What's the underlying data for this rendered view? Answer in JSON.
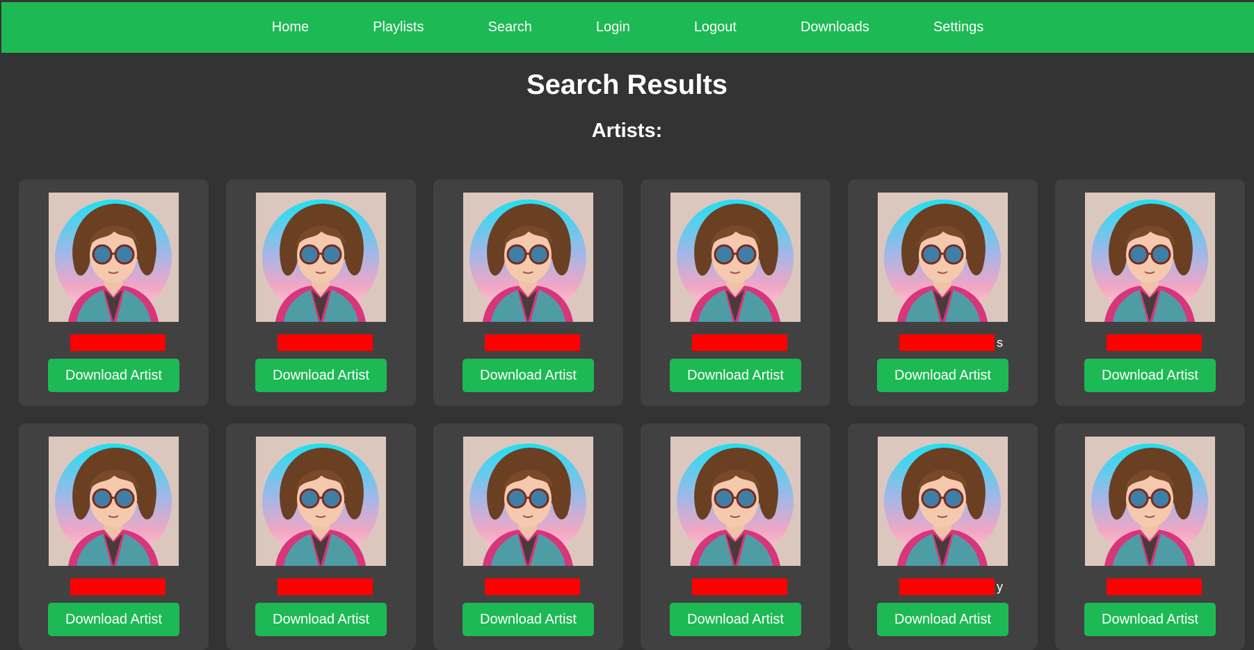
{
  "nav": {
    "items": [
      "Home",
      "Playlists",
      "Search",
      "Login",
      "Logout",
      "Downloads",
      "Settings"
    ]
  },
  "page": {
    "title": "Search Results",
    "section_title": "Artists:"
  },
  "colors": {
    "accent": "#1db954",
    "background": "#333333",
    "card": "#414141",
    "redaction": "#ff0000"
  },
  "artists": [
    {
      "name_tail": "",
      "button_label": "Download Artist"
    },
    {
      "name_tail": "",
      "button_label": "Download Artist"
    },
    {
      "name_tail": "",
      "button_label": "Download Artist"
    },
    {
      "name_tail": "",
      "button_label": "Download Artist"
    },
    {
      "name_tail": "s",
      "button_label": "Download Artist"
    },
    {
      "name_tail": "",
      "button_label": "Download Artist"
    },
    {
      "name_tail": "",
      "button_label": "Download Artist"
    },
    {
      "name_tail": "",
      "button_label": "Download Artist"
    },
    {
      "name_tail": "",
      "button_label": "Download Artist"
    },
    {
      "name_tail": "",
      "button_label": "Download Artist"
    },
    {
      "name_tail": "y",
      "button_label": "Download Artist"
    },
    {
      "name_tail": "",
      "button_label": "Download Artist"
    }
  ]
}
